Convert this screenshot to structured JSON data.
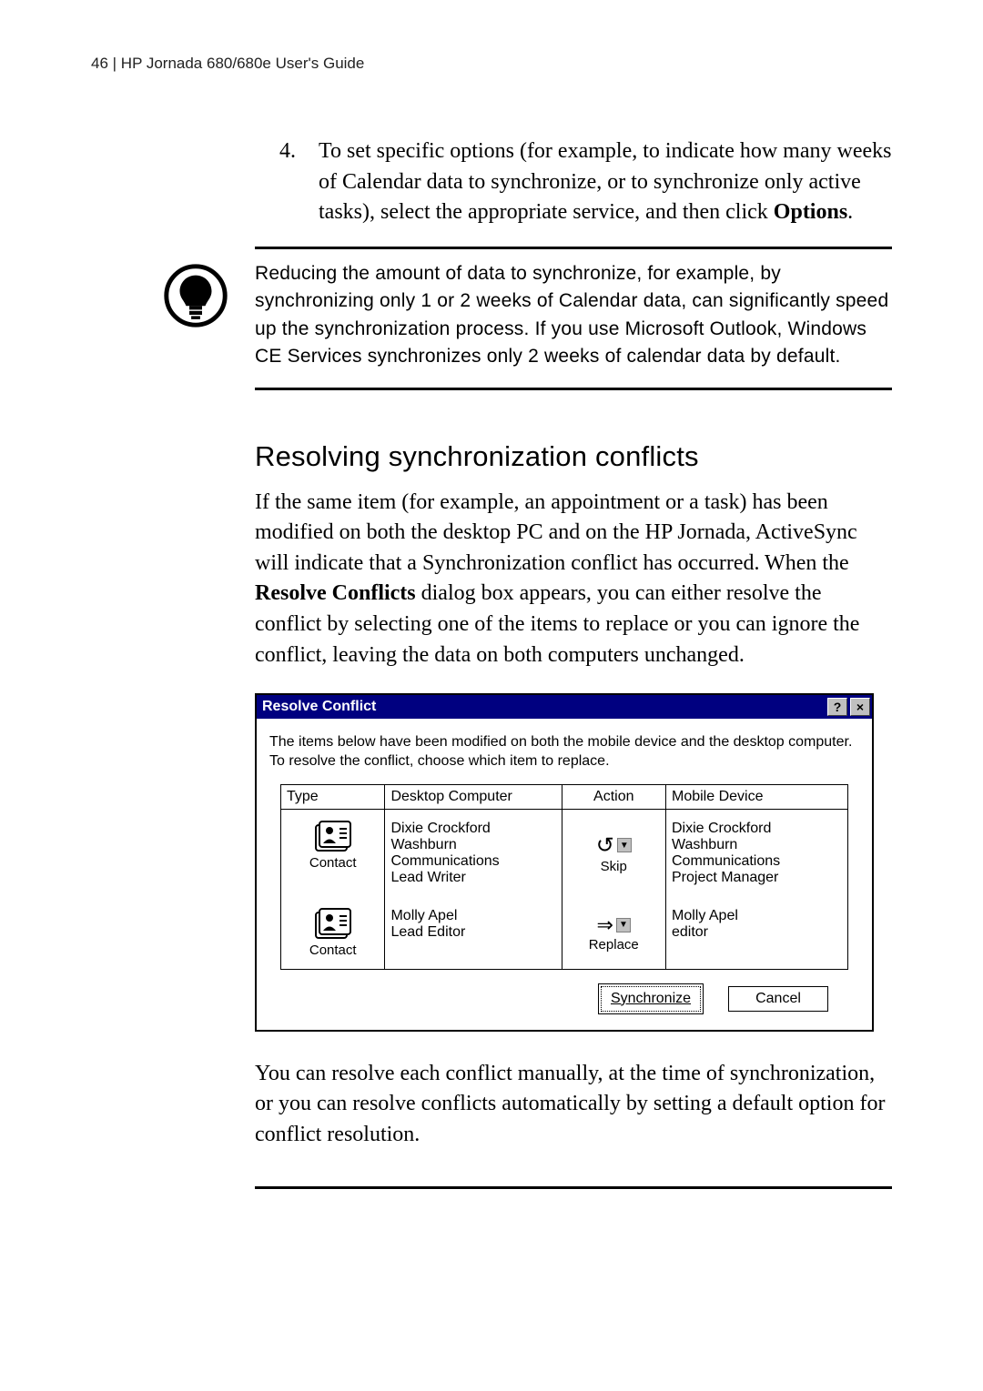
{
  "header": {
    "page_number": "46",
    "divider": " | ",
    "title": "HP Jornada 680/680e User's Guide"
  },
  "step": {
    "number": "4.",
    "text_before": "To set specific options (for example, to indicate how many weeks of Calendar data to synchronize, or to synchronize only active tasks), select the appropriate service, and then click ",
    "bold": "Options",
    "text_after": "."
  },
  "tip": {
    "text": "Reducing the amount of data to synchronize, for example, by synchronizing only 1 or 2 weeks of Calendar data, can significantly speed up the synchronization process. If you use Microsoft Outlook, Windows CE Services synchronizes only 2 weeks of calendar data by default."
  },
  "section": {
    "heading": "Resolving synchronization conflicts",
    "para1_before": "If the same item (for example, an appointment or a task) has been modified on both the desktop PC and on the HP Jornada, ActiveSync will indicate that a Synchronization conflict has occurred. When the ",
    "para1_bold": "Resolve Conflicts",
    "para1_after": " dialog box appears, you can either resolve the conflict by selecting one of the items to replace or you can ignore the conflict, leaving the data on both computers unchanged.",
    "para2": "You can resolve each conflict manually, at the time of synchronization, or you can resolve conflicts automatically by setting a default option for conflict resolution."
  },
  "dialog": {
    "title": "Resolve Conflict",
    "help": "?",
    "close": "×",
    "intro": "The items below have been modified on both the mobile device and the desktop computer. To resolve the conflict, choose which item to replace.",
    "columns": {
      "type": "Type",
      "desktop": "Desktop Computer",
      "action": "Action",
      "mobile": "Mobile Device"
    },
    "rows": [
      {
        "type": "Contact",
        "desktop": "Dixie Crockford\nWashburn Communications\nLead Writer",
        "action": "Skip",
        "action_glyph": "↺",
        "mobile": "Dixie Crockford\nWashburn Communications\nProject Manager"
      },
      {
        "type": "Contact",
        "desktop": "Molly Apel\nLead Editor",
        "action": "Replace",
        "action_glyph": "⇒",
        "mobile": "Molly Apel\neditor"
      }
    ],
    "buttons": {
      "sync": "Synchronize",
      "cancel": "Cancel"
    }
  }
}
